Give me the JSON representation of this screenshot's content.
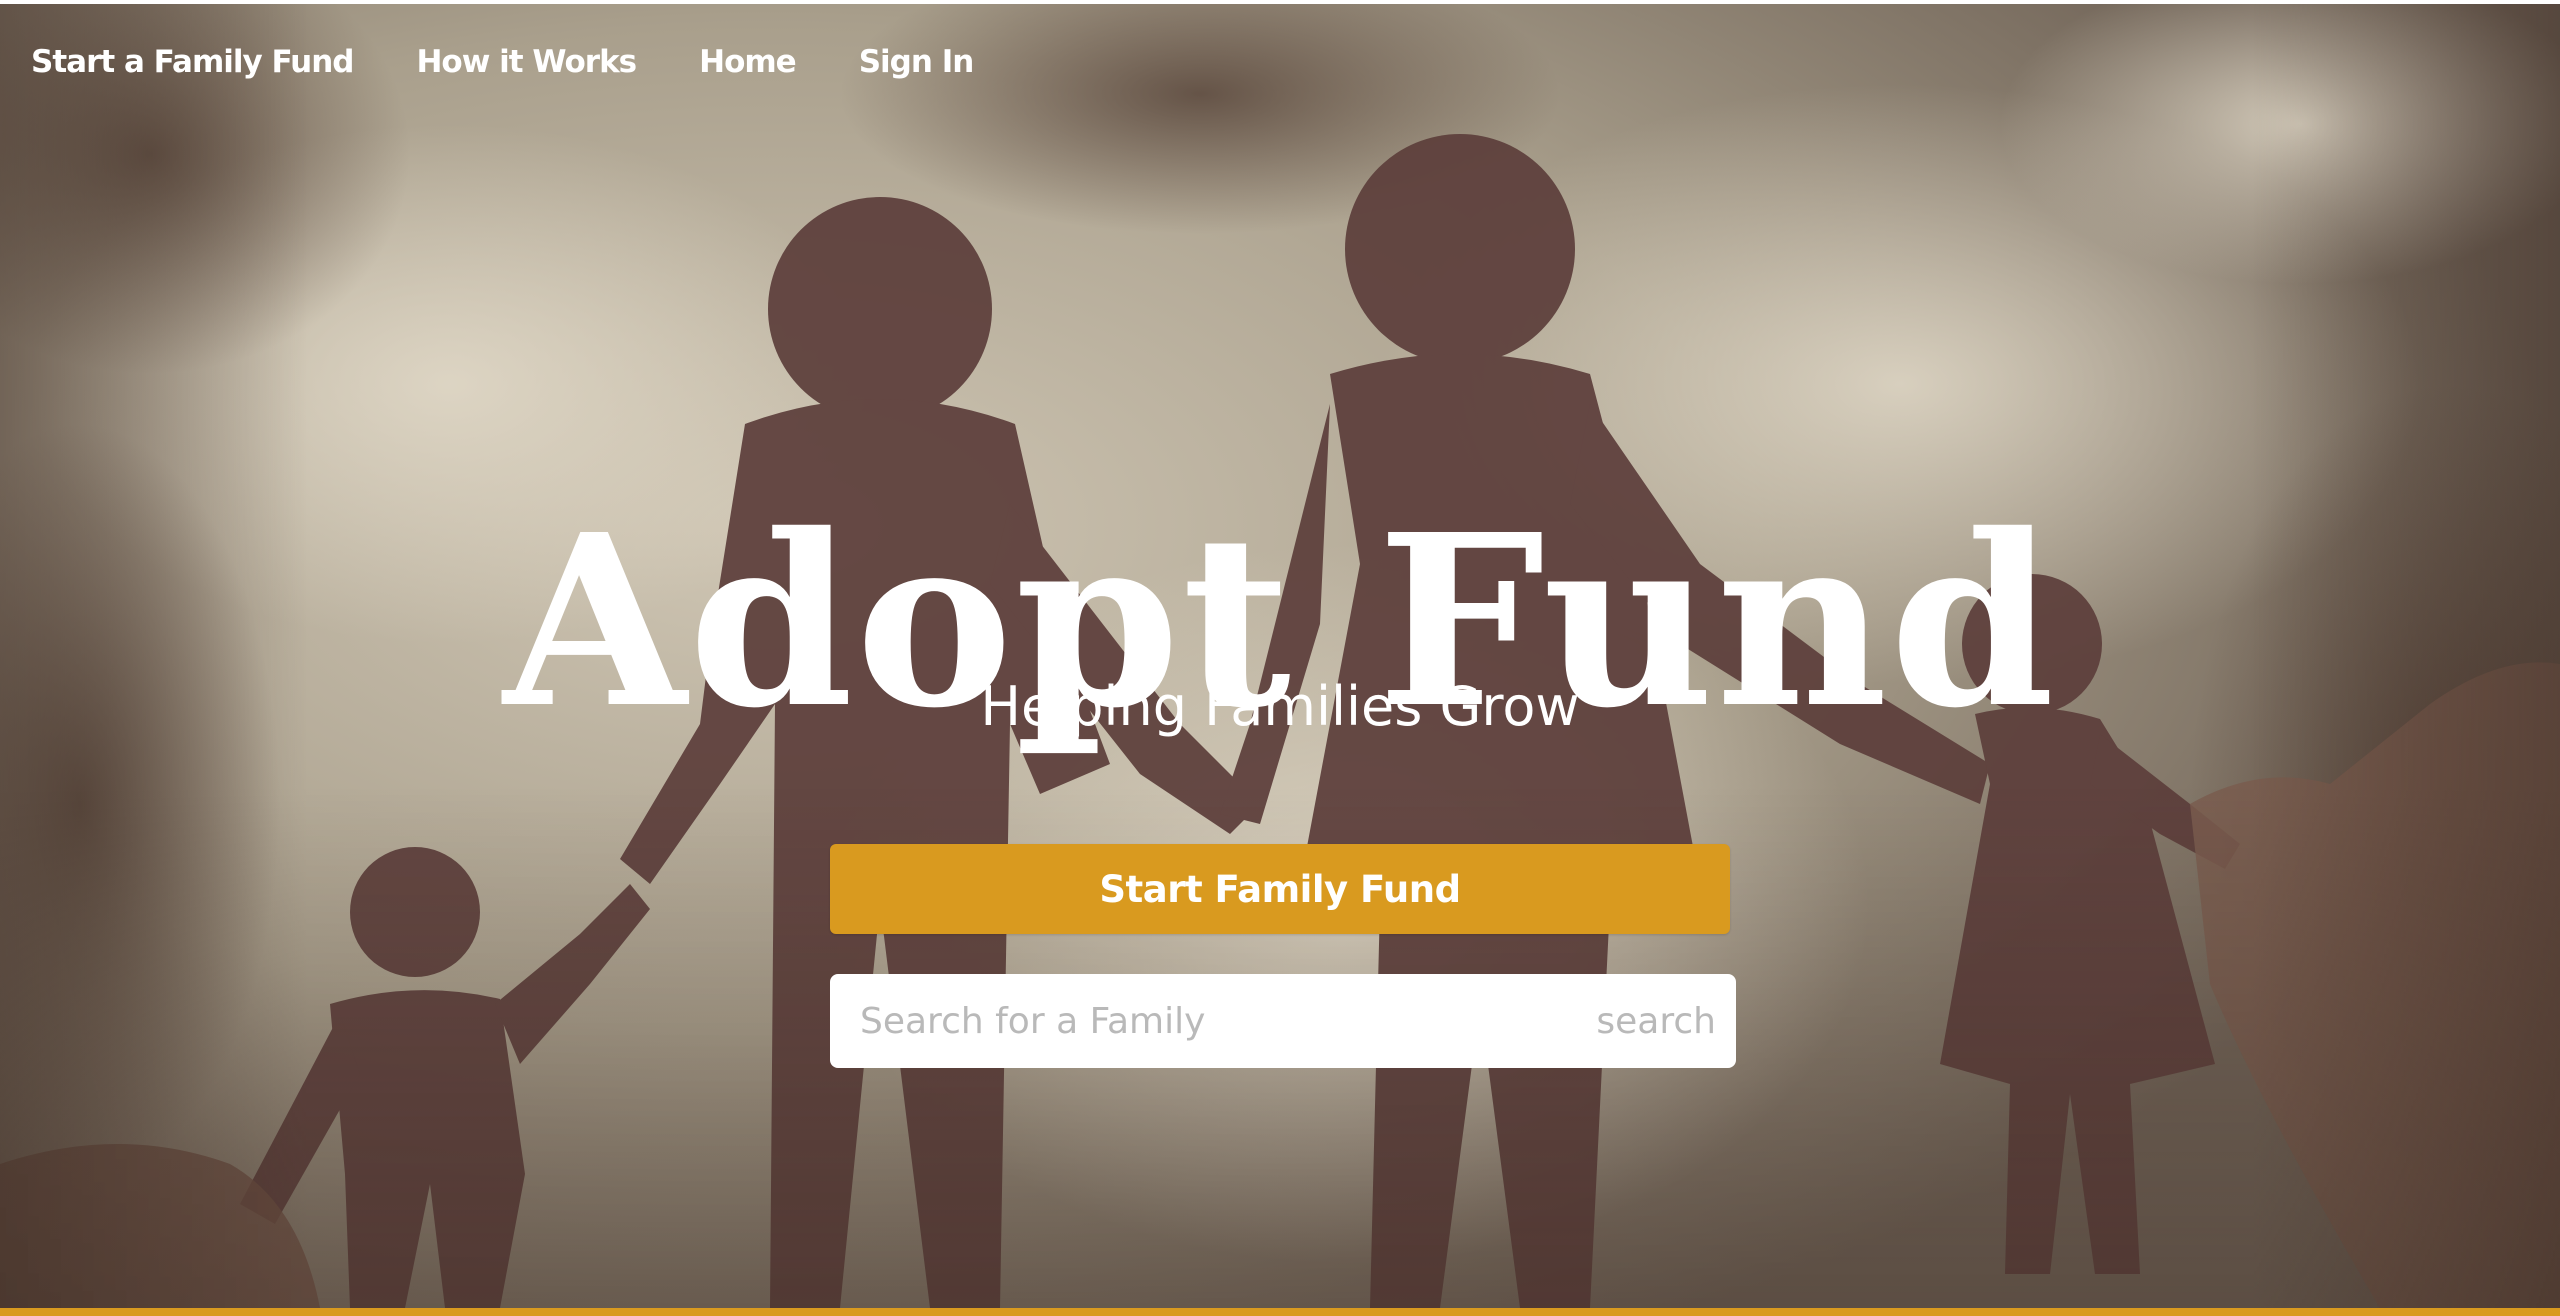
{
  "nav": {
    "items": [
      {
        "label": "Start a Family Fund"
      },
      {
        "label": "How it Works"
      },
      {
        "label": "Home"
      },
      {
        "label": "Sign In"
      }
    ]
  },
  "hero": {
    "title": "Adopt Fund",
    "subtitle": "Helping Families Grow",
    "cta_label": "Start Family Fund"
  },
  "search": {
    "placeholder": "Search for a Family",
    "value": "",
    "button_label": "search"
  },
  "colors": {
    "accent": "#d99a1f",
    "text_on_hero": "#ffffff",
    "background_tone": "#8e8577",
    "silhouette": "#5d3f3c"
  }
}
